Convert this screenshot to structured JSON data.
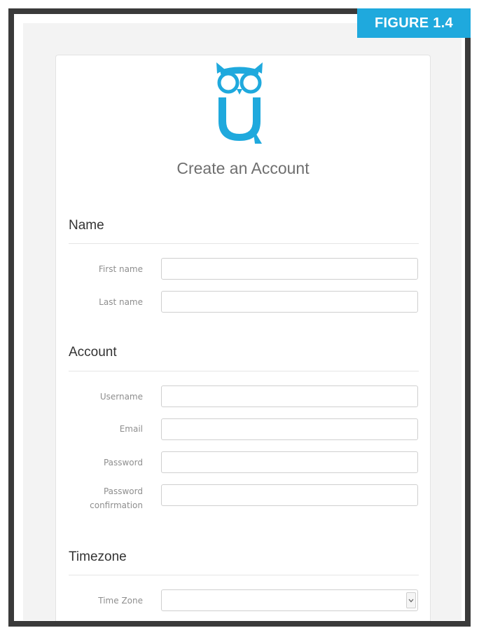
{
  "figure_label": "FIGURE 1.4",
  "form": {
    "title": "Create an Account"
  },
  "sections": {
    "name": {
      "heading": "Name",
      "fields": {
        "first_name": "First name",
        "last_name": "Last name"
      }
    },
    "account": {
      "heading": "Account",
      "fields": {
        "username": "Username",
        "email": "Email",
        "password": "Password",
        "password_confirmation_line1": "Password",
        "password_confirmation_line2": "confirmation"
      }
    },
    "timezone": {
      "heading": "Timezone",
      "fields": {
        "time_zone": "Time Zone",
        "time_zone_value": ""
      }
    }
  },
  "colors": {
    "brand": "#1fa9dd",
    "frame": "#3a3a3a",
    "background": "#f3f3f3"
  },
  "icons": {
    "logo": "owl-u-logo",
    "select_arrow": "chevron-down-icon"
  }
}
